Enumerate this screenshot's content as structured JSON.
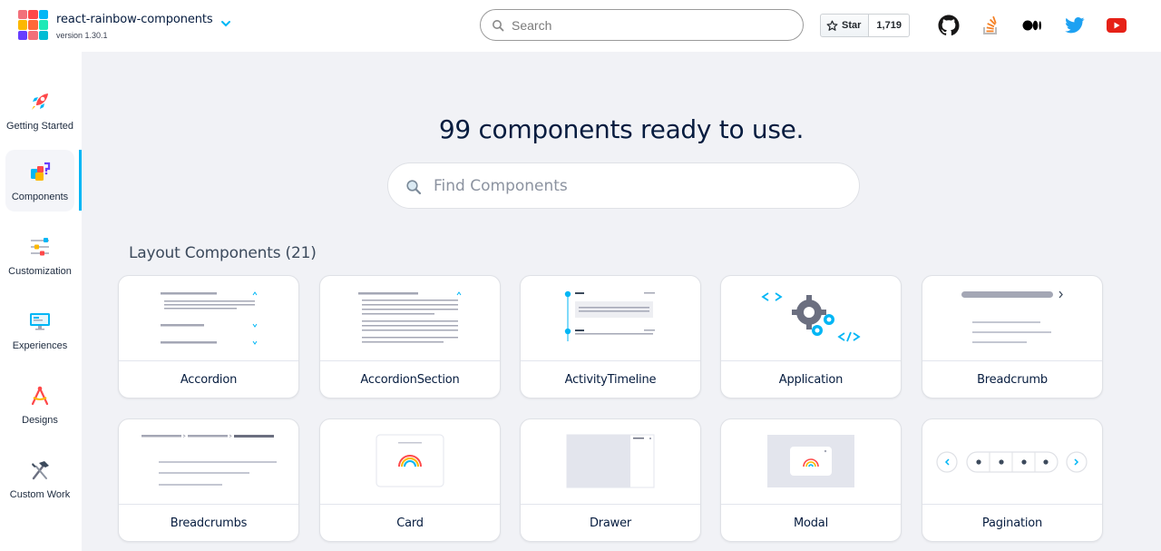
{
  "header": {
    "brand_name": "react-rainbow-components",
    "version": "version 1.30.1",
    "logo_colors": [
      "#f2707a",
      "#fe4849",
      "#01b6f5",
      "#fcb800",
      "#ff6837",
      "#1de9b6",
      "#663dff",
      "#f2707a",
      "#00bcd4"
    ],
    "search_placeholder": "Search",
    "star_label": "Star",
    "star_count": "1,719",
    "social_icons": [
      "github-icon",
      "stackoverflow-icon",
      "medium-icon",
      "twitter-icon",
      "youtube-icon"
    ]
  },
  "sidebar": {
    "items": [
      {
        "label": "Getting Started",
        "icon": "rocket-icon"
      },
      {
        "label": "Components",
        "icon": "puzzle-icon",
        "active": true
      },
      {
        "label": "Customization",
        "icon": "sliders-icon"
      },
      {
        "label": "Experiences",
        "icon": "monitor-icon"
      },
      {
        "label": "Designs",
        "icon": "compass-icon"
      },
      {
        "label": "Custom Work",
        "icon": "hammer-icon"
      }
    ]
  },
  "main": {
    "title": "99 components ready to use.",
    "find_placeholder": "Find Components",
    "section_title": "Layout Components (21)",
    "cards": [
      {
        "label": "Accordion"
      },
      {
        "label": "AccordionSection"
      },
      {
        "label": "ActivityTimeline"
      },
      {
        "label": "Application"
      },
      {
        "label": "Breadcrumb"
      },
      {
        "label": "Breadcrumbs"
      },
      {
        "label": "Card"
      },
      {
        "label": "Drawer"
      },
      {
        "label": "Modal"
      },
      {
        "label": "Pagination"
      }
    ]
  },
  "colors": {
    "accent": "#01b6f5",
    "background": "#f1f2f6",
    "text": "#061c3f"
  }
}
